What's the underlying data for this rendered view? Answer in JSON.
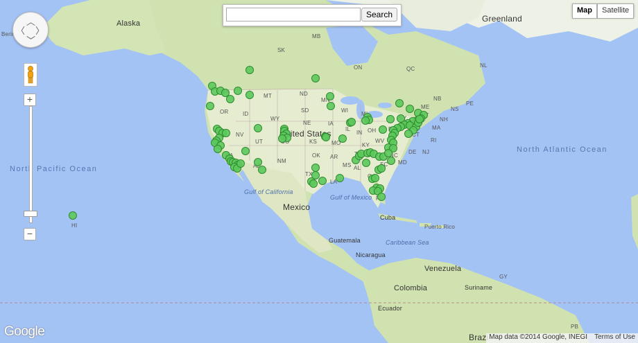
{
  "search": {
    "placeholder": "",
    "value": "",
    "button_label": "Search"
  },
  "map_type": {
    "options": [
      "Map",
      "Satellite"
    ],
    "active": "Map"
  },
  "controls": {
    "pan_icon": "pan-control-icon",
    "pegman_icon": "street-view-pegman-icon",
    "zoom_in": "+",
    "zoom_out": "−",
    "zoom_level_fraction": 0.92
  },
  "branding": {
    "logo": "Google"
  },
  "attribution": {
    "data": "Map data ©2014 Google, INEGI",
    "terms": "Terms of Use"
  },
  "marker_color": "#5cc95c",
  "marker_stroke": "#2e8b2e",
  "labels": {
    "countries": {
      "greenland": "Greenland",
      "alaska": "Alaska",
      "us": "United States",
      "mexico": "Mexico",
      "cuba": "Cuba",
      "guatemala": "Guatemala",
      "nicaragua": "Nicaragua",
      "venezuela": "Venezuela",
      "colombia": "Colombia",
      "suriname": "Suriname",
      "ecuador": "Ecuador",
      "brazil": "Brazi"
    },
    "seas": {
      "gulf_ca": "Gulf of California",
      "gulf_mx": "Gulf of Mexico",
      "caribbean": "Caribbean Sea"
    },
    "oceans": {
      "n_pacific": "North Pacific Ocean",
      "n_atlantic": "North Atlantic Ocean"
    },
    "regions": [
      "Bering",
      "MB",
      "SK",
      "ON",
      "QC",
      "NL",
      "PE",
      "NS",
      "NB",
      "ME",
      "NH",
      "MA",
      "RI",
      "CT",
      "NJ",
      "DE",
      "MD",
      "NY",
      "PA",
      "VT",
      "OH",
      "WV",
      "VA",
      "KY",
      "TN",
      "IN",
      "MI",
      "WI",
      "MN",
      "IA",
      "MO",
      "IL",
      "KS",
      "NE",
      "SD",
      "ND",
      "MT",
      "WY",
      "ID",
      "OR",
      "WA",
      "NV",
      "UT",
      "CO",
      "CA",
      "AZ",
      "NM",
      "TX",
      "OK",
      "AR",
      "LA",
      "MS",
      "AL",
      "GA",
      "SC",
      "FL",
      "NC",
      "HI",
      "Puerto Rico",
      "PB",
      "GY"
    ]
  },
  "markers_count": 120
}
